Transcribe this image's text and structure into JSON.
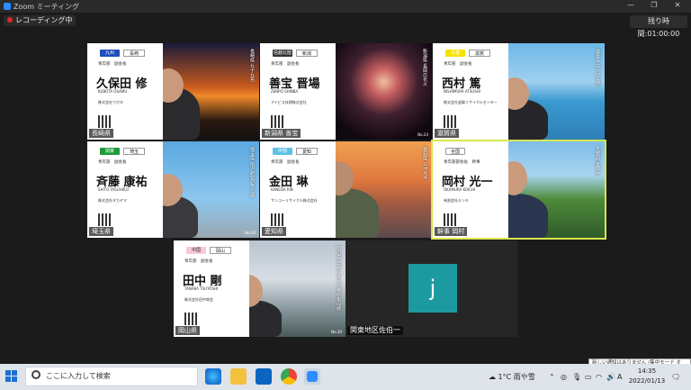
{
  "window": {
    "title": "Zoom ミーティング"
  },
  "recording": {
    "label": "レコーディング中"
  },
  "timer": {
    "label": "残り時間:",
    "value": "01:00:00"
  },
  "participants": [
    {
      "region": "九州",
      "region_color": "#1f4fbf",
      "pref": "長崎",
      "role": "青年部　副会長",
      "name_jp": "久保田 修",
      "name_en": "KUBOTA OSAMU",
      "company": "株式会社ウボタ",
      "vertical": "長崎県 九十九島",
      "label": "長崎県",
      "page": ""
    },
    {
      "region": "信越北陸",
      "region_color": "#333333",
      "pref": "新潟",
      "role": "青年部　副会長",
      "name_jp": "善宝 晋場",
      "name_en": "ZENPO SHINBA",
      "company": "アイビス技建株式会社",
      "vertical": "新潟県 長岡の花火",
      "label": "新潟県 善宝",
      "page": "No.24"
    },
    {
      "region": "近畿",
      "region_color": "#f5e100",
      "pref": "滋賀",
      "role": "青年部　副会長",
      "name_jp": "西村 篤",
      "name_en": "NISHIMURA ATSUSHI",
      "company": "株式会社滋賀リサイクルセンター",
      "vertical": "滋賀県 白ひげ鳥居",
      "label": "滋賀県",
      "page": ""
    },
    {
      "region": "関東",
      "region_color": "#1e9b3a",
      "pref": "埼玉",
      "role": "青年部　副会長",
      "name_jp": "斉藤 康祐",
      "name_en": "SAITO YASUHIRO",
      "company": "株式会社タカヤマ",
      "vertical": "埼玉県 所沢航空記念公園",
      "label": "埼玉県",
      "page": "No.20"
    },
    {
      "region": "中部",
      "region_color": "#5cc1e6",
      "pref": "愛知",
      "role": "青年部　副会長",
      "name_jp": "金田 琳",
      "name_en": "KANEDA RIN",
      "company": "サンコーリサイクル株式会社",
      "vertical": "愛知県 三河大浜",
      "label": "愛知県",
      "page": ""
    },
    {
      "region": "全国",
      "region_color": "#ffffff",
      "pref": "",
      "role": "青年部部会長　幹事",
      "name_jp": "岡村 光一",
      "name_en": "OKAMURA KOICHI",
      "company": "有限会社キンキ",
      "vertical": "京都府 金閣寺",
      "label": "幹事 岡村",
      "page": ""
    },
    {
      "region": "中国",
      "region_color": "#f7c9d9",
      "pref": "岡山",
      "role": "青年部　副会長",
      "name_jp": "田中 剛",
      "name_en": "TANAKA TSUYOSHI",
      "company": "株式会社田中商会",
      "vertical": "岡山県 雲海に浮かぶ備中松山城",
      "label": "岡山県",
      "page": "No.30"
    }
  ],
  "avatar_tile": {
    "letter": "j",
    "label": "関東地区佐伯一"
  },
  "taskbar": {
    "search_placeholder": "ここに入力して検索",
    "weather": "1°C 雨や雪",
    "ime": "A",
    "time": "14:35",
    "date": "2022/01/13"
  },
  "notification": "新しい通知はありません (集中モード オン)"
}
